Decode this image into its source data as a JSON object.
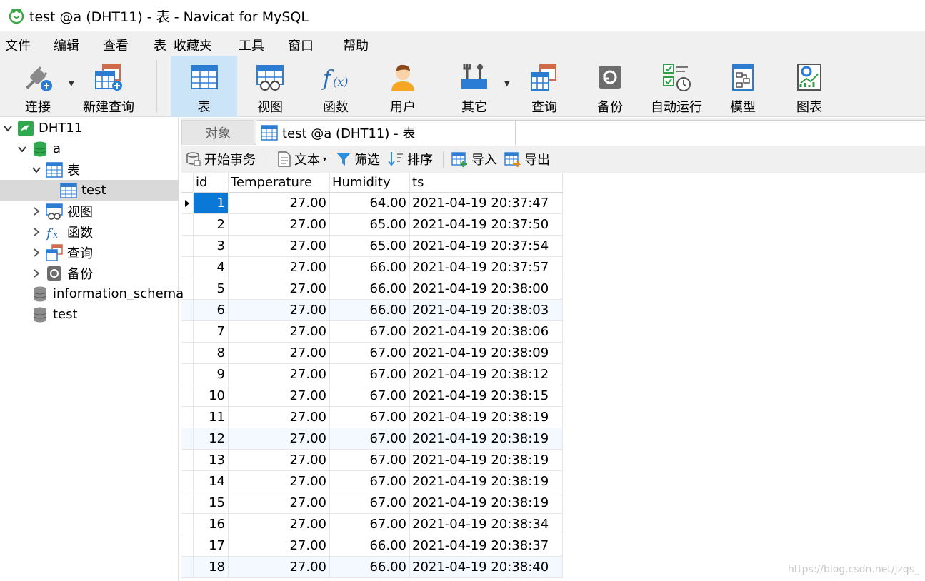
{
  "window": {
    "title": "test @a (DHT11) - 表 - Navicat for MySQL"
  },
  "menu": [
    "文件",
    "编辑",
    "查看",
    "表",
    "收藏夹",
    "工具",
    "窗口",
    "帮助"
  ],
  "toolbar": {
    "connect": "连接",
    "new_query": "新建查询",
    "table": "表",
    "view": "视图",
    "function": "函数",
    "user": "用户",
    "other": "其它",
    "query": "查询",
    "backup": "备份",
    "automation": "自动运行",
    "model": "模型",
    "chart": "图表"
  },
  "sidebar": {
    "connection": "DHT11",
    "database": "a",
    "tables_group": "表",
    "table_item": "test",
    "views": "视图",
    "functions": "函数",
    "queries": "查询",
    "backups": "备份",
    "db2": "information_schema",
    "db3": "test"
  },
  "tabs": {
    "objects": "对象",
    "active": "test @a (DHT11) - 表"
  },
  "subtoolbar": {
    "begin_tx": "开始事务",
    "text": "文本",
    "filter": "筛选",
    "sort": "排序",
    "import": "导入",
    "export": "导出"
  },
  "grid": {
    "columns": [
      "id",
      "Temperature",
      "Humidity",
      "ts"
    ],
    "rows": [
      [
        "1",
        "27.00",
        "64.00",
        "2021-04-19 20:37:47"
      ],
      [
        "2",
        "27.00",
        "65.00",
        "2021-04-19 20:37:50"
      ],
      [
        "3",
        "27.00",
        "65.00",
        "2021-04-19 20:37:54"
      ],
      [
        "4",
        "27.00",
        "66.00",
        "2021-04-19 20:37:57"
      ],
      [
        "5",
        "27.00",
        "66.00",
        "2021-04-19 20:38:00"
      ],
      [
        "6",
        "27.00",
        "66.00",
        "2021-04-19 20:38:03"
      ],
      [
        "7",
        "27.00",
        "67.00",
        "2021-04-19 20:38:06"
      ],
      [
        "8",
        "27.00",
        "67.00",
        "2021-04-19 20:38:09"
      ],
      [
        "9",
        "27.00",
        "67.00",
        "2021-04-19 20:38:12"
      ],
      [
        "10",
        "27.00",
        "67.00",
        "2021-04-19 20:38:15"
      ],
      [
        "11",
        "27.00",
        "67.00",
        "2021-04-19 20:38:19"
      ],
      [
        "12",
        "27.00",
        "67.00",
        "2021-04-19 20:38:19"
      ],
      [
        "13",
        "27.00",
        "67.00",
        "2021-04-19 20:38:19"
      ],
      [
        "14",
        "27.00",
        "67.00",
        "2021-04-19 20:38:19"
      ],
      [
        "15",
        "27.00",
        "67.00",
        "2021-04-19 20:38:19"
      ],
      [
        "16",
        "27.00",
        "67.00",
        "2021-04-19 20:38:34"
      ],
      [
        "17",
        "27.00",
        "66.00",
        "2021-04-19 20:38:37"
      ],
      [
        "18",
        "27.00",
        "66.00",
        "2021-04-19 20:38:40"
      ]
    ]
  },
  "watermark": "https://blog.csdn.net/jzqs_",
  "colors": {
    "selection": "#0a78d7",
    "active_tool": "#cce4f7",
    "chrome": "#f0f0f0"
  }
}
